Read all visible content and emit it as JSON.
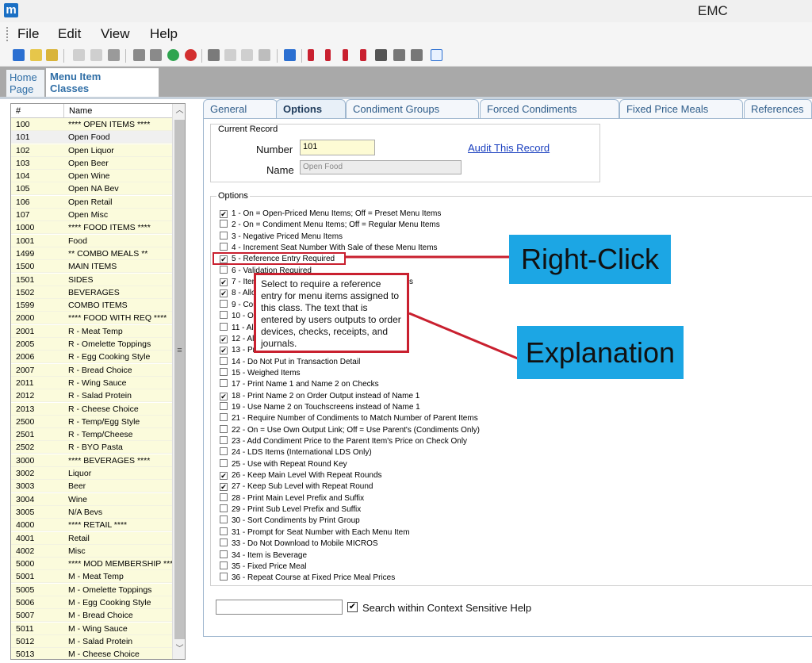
{
  "window": {
    "title": "EMC",
    "logo_letter": "m"
  },
  "menu": [
    "File",
    "Edit",
    "View",
    "Help"
  ],
  "home_tab": {
    "line1": "Home",
    "line2": "Page"
  },
  "section_tab": {
    "line1": "Menu Item",
    "line2": "Classes"
  },
  "list": {
    "col_num": "#",
    "col_name": "Name",
    "rows": [
      {
        "num": "100",
        "name": "**** OPEN ITEMS ****"
      },
      {
        "num": "101",
        "name": "Open Food"
      },
      {
        "num": "102",
        "name": "Open Liquor"
      },
      {
        "num": "103",
        "name": "Open Beer"
      },
      {
        "num": "104",
        "name": "Open Wine"
      },
      {
        "num": "105",
        "name": "Open NA Bev"
      },
      {
        "num": "106",
        "name": "Open Retail"
      },
      {
        "num": "107",
        "name": "Open Misc"
      },
      {
        "num": "1000",
        "name": "**** FOOD ITEMS ****"
      },
      {
        "num": "1001",
        "name": "Food"
      },
      {
        "num": "1499",
        "name": "** COMBO MEALS **"
      },
      {
        "num": "1500",
        "name": "MAIN ITEMS"
      },
      {
        "num": "1501",
        "name": "SIDES"
      },
      {
        "num": "1502",
        "name": "BEVERAGES"
      },
      {
        "num": "1599",
        "name": "COMBO ITEMS"
      },
      {
        "num": "2000",
        "name": "**** FOOD WITH REQ ****"
      },
      {
        "num": "2001",
        "name": "R - Meat Temp"
      },
      {
        "num": "2005",
        "name": "R - Omelette Toppings"
      },
      {
        "num": "2006",
        "name": "R - Egg Cooking Style"
      },
      {
        "num": "2007",
        "name": "R - Bread Choice"
      },
      {
        "num": "2011",
        "name": "R - Wing Sauce"
      },
      {
        "num": "2012",
        "name": "R - Salad Protein"
      },
      {
        "num": "2013",
        "name": "R - Cheese Choice"
      },
      {
        "num": "2500",
        "name": "R - Temp/Egg Style"
      },
      {
        "num": "2501",
        "name": "R - Temp/Cheese"
      },
      {
        "num": "2502",
        "name": "R - BYO Pasta"
      },
      {
        "num": "3000",
        "name": "**** BEVERAGES ****"
      },
      {
        "num": "3002",
        "name": "Liquor"
      },
      {
        "num": "3003",
        "name": "Beer"
      },
      {
        "num": "3004",
        "name": "Wine"
      },
      {
        "num": "3005",
        "name": "N/A Bevs"
      },
      {
        "num": "4000",
        "name": "**** RETAIL ****"
      },
      {
        "num": "4001",
        "name": "Retail"
      },
      {
        "num": "4002",
        "name": "Misc"
      },
      {
        "num": "5000",
        "name": "**** MOD MEMBERSHIP ****"
      },
      {
        "num": "5001",
        "name": "M - Meat Temp"
      },
      {
        "num": "5005",
        "name": "M - Omelette Toppings"
      },
      {
        "num": "5006",
        "name": "M - Egg Cooking Style"
      },
      {
        "num": "5007",
        "name": "M - Bread Choice"
      },
      {
        "num": "5011",
        "name": "M - Wing Sauce"
      },
      {
        "num": "5012",
        "name": "M - Salad Protein"
      },
      {
        "num": "5013",
        "name": "M - Cheese Choice"
      }
    ],
    "selected_index": 1
  },
  "tabs": [
    "General",
    "Options",
    "Condiment Groups",
    "Forced Condiments",
    "Fixed Price Meals",
    "References"
  ],
  "active_tab": "Options",
  "current_record": {
    "legend": "Current Record",
    "number_label": "Number",
    "number_value": "101",
    "name_label": "Name",
    "name_value": "Open Food",
    "audit_link": "Audit This Record"
  },
  "options": {
    "legend": "Options",
    "items": [
      {
        "label": "1 - On = Open-Priced Menu Items; Off = Preset Menu Items",
        "checked": true
      },
      {
        "label": "2 - On = Condiment Menu Items; Off = Regular Menu Items",
        "checked": false
      },
      {
        "label": "3 - Negative Priced Menu Items",
        "checked": false
      },
      {
        "label": "4 - Increment Seat Number With Sale of these Menu Items",
        "checked": false
      },
      {
        "label": "5 - Reference Entry Required",
        "checked": true
      },
      {
        "label": "6 - Validation Required",
        "checked": false
      },
      {
        "label": "7 - Item is Shareable with Sale of these Menu Items",
        "checked": true
      },
      {
        "label": "8 - Allow Menu Item Condiments to be Priced",
        "checked": true
      },
      {
        "label": "9 - Count Menu Items as Items for Menu Item",
        "checked": false
      },
      {
        "label": "10 - On = Open Level Pricing; Off = Level Pricing",
        "checked": false
      },
      {
        "label": "11 - Allow Adjustment",
        "checked": false
      },
      {
        "label": "12 - Allow",
        "checked": true
      },
      {
        "label": "13 - Print",
        "checked": true
      },
      {
        "label": "14 - Do Not Put in Transaction Detail",
        "checked": false
      },
      {
        "label": "15 - Weighed Items",
        "checked": false
      },
      {
        "label": "17 - Print Name 1 and Name 2 on Checks",
        "checked": false
      },
      {
        "label": "18 - Print Name 2 on Order Output instead of Name 1",
        "checked": true
      },
      {
        "label": "19 - Use Name 2 on Touchscreens instead of Name 1",
        "checked": false
      },
      {
        "label": "21 - Require Number of Condiments to Match Number of Parent Items",
        "checked": false
      },
      {
        "label": "22 - On = Use Own Output Link; Off = Use Parent's (Condiments Only)",
        "checked": false
      },
      {
        "label": "23 - Add Condiment Price to the Parent Item's Price on Check Only",
        "checked": false
      },
      {
        "label": "24 - LDS Items (International LDS Only)",
        "checked": false
      },
      {
        "label": "25 - Use with Repeat Round Key",
        "checked": false
      },
      {
        "label": "26 - Keep Main Level With Repeat Rounds",
        "checked": true
      },
      {
        "label": "27 - Keep Sub Level with Repeat Round",
        "checked": true
      },
      {
        "label": "28 - Print Main Level Prefix and Suffix",
        "checked": false
      },
      {
        "label": "29 - Print Sub Level Prefix and Suffix",
        "checked": false
      },
      {
        "label": "30 - Sort Condiments by Print Group",
        "checked": false
      },
      {
        "label": "31 - Prompt for Seat Number with Each Menu Item",
        "checked": false
      },
      {
        "label": "33 - Do Not Download to Mobile MICROS",
        "checked": false
      },
      {
        "label": "34 - Item is Beverage",
        "checked": false
      },
      {
        "label": "35 - Fixed Price Meal",
        "checked": false
      },
      {
        "label": "36 - Repeat Course at Fixed Price Meal Prices",
        "checked": false
      }
    ]
  },
  "search": {
    "value": "",
    "checkbox_label": "Search within Context Sensitive Help",
    "checked": true
  },
  "annotations": {
    "tooltip": "Select to require a reference entry for menu items assigned to this class. The text that is entered by users outputs to order devices, checks, receipts, and journals.",
    "right_click_label": "Right-Click",
    "explanation_label": "Explanation",
    "accent_color": "#c9202f",
    "label_bg": "#1ca6e4"
  }
}
